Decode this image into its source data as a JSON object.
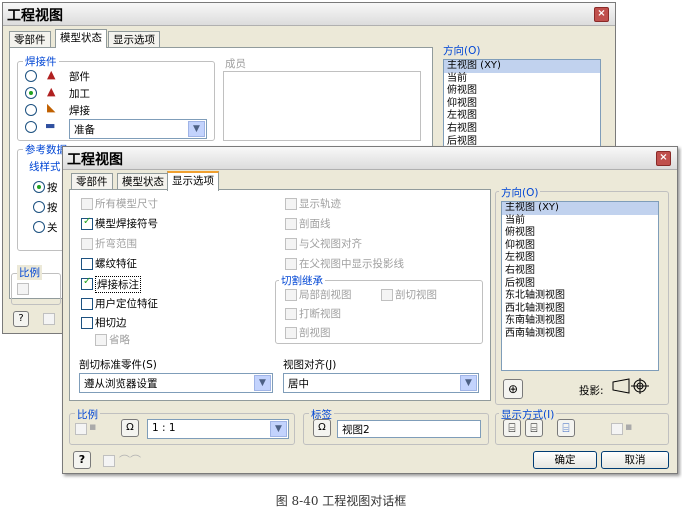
{
  "back_window": {
    "title": "工程视图",
    "tabs": [
      "零部件",
      "模型状态",
      "显示选项"
    ],
    "weldment_group": "焊接件",
    "weldment_options": [
      "部件",
      "加工",
      "焊接",
      ""
    ],
    "weldment_combo": "准备",
    "members_label": "成员",
    "reference_group": "参考数据",
    "line_style_label": "线样式",
    "ref_radios": [
      "按",
      "按",
      "关"
    ],
    "orientation_label": "方向(O)",
    "orientation_items": [
      "主视图 (XY)",
      "当前",
      "俯视图",
      "仰视图",
      "左视图",
      "右视图",
      "后视图"
    ],
    "scale_label": "比例"
  },
  "front_window": {
    "title": "工程视图",
    "tabs": [
      "零部件",
      "模型状态",
      "显示选项"
    ],
    "left_checks": [
      {
        "label": "所有模型尺寸",
        "checked": false,
        "enabled": false
      },
      {
        "label": "模型焊接符号",
        "checked": true,
        "enabled": true
      },
      {
        "label": "折弯范围",
        "checked": false,
        "enabled": false
      },
      {
        "label": "螺纹特征",
        "checked": false,
        "enabled": true
      },
      {
        "label": "焊接标注",
        "checked": true,
        "enabled": true
      },
      {
        "label": "用户定位特征",
        "checked": false,
        "enabled": true
      },
      {
        "label": "相切边",
        "checked": false,
        "enabled": true
      },
      {
        "label": "省略",
        "checked": false,
        "enabled": false
      }
    ],
    "right_checks": [
      {
        "label": "显示轨迹",
        "enabled": false
      },
      {
        "label": "剖面线",
        "enabled": false
      },
      {
        "label": "与父视图对齐",
        "enabled": false
      },
      {
        "label": "在父视图中显示投影线",
        "enabled": false
      }
    ],
    "cut_group_label": "切割继承",
    "cut_checks": [
      "局部剖视图",
      "剖切视图",
      "打断视图",
      "剖视图"
    ],
    "section_std_label": "剖切标准零件(S)",
    "section_std_value": "遵从浏览器设置",
    "view_align_label": "视图对齐(J)",
    "view_align_value": "居中",
    "orientation_label": "方向(O)",
    "orientation_items": [
      "主视图 (XY)",
      "当前",
      "俯视图",
      "仰视图",
      "左视图",
      "右视图",
      "后视图",
      "东北轴测视图",
      "西北轴测视图",
      "东南轴测视图",
      "西南轴测视图"
    ],
    "orientation_selected": 0,
    "projection_label": "投影:",
    "scale_label": "比例",
    "scale_value": "1 : 1",
    "label_group": "标签",
    "label_value": "视图2",
    "display_mode_label": "显示方式(I)",
    "ok": "确定",
    "cancel": "取消",
    "help": "?"
  },
  "caption": "图 8-40  工程视图对话框"
}
